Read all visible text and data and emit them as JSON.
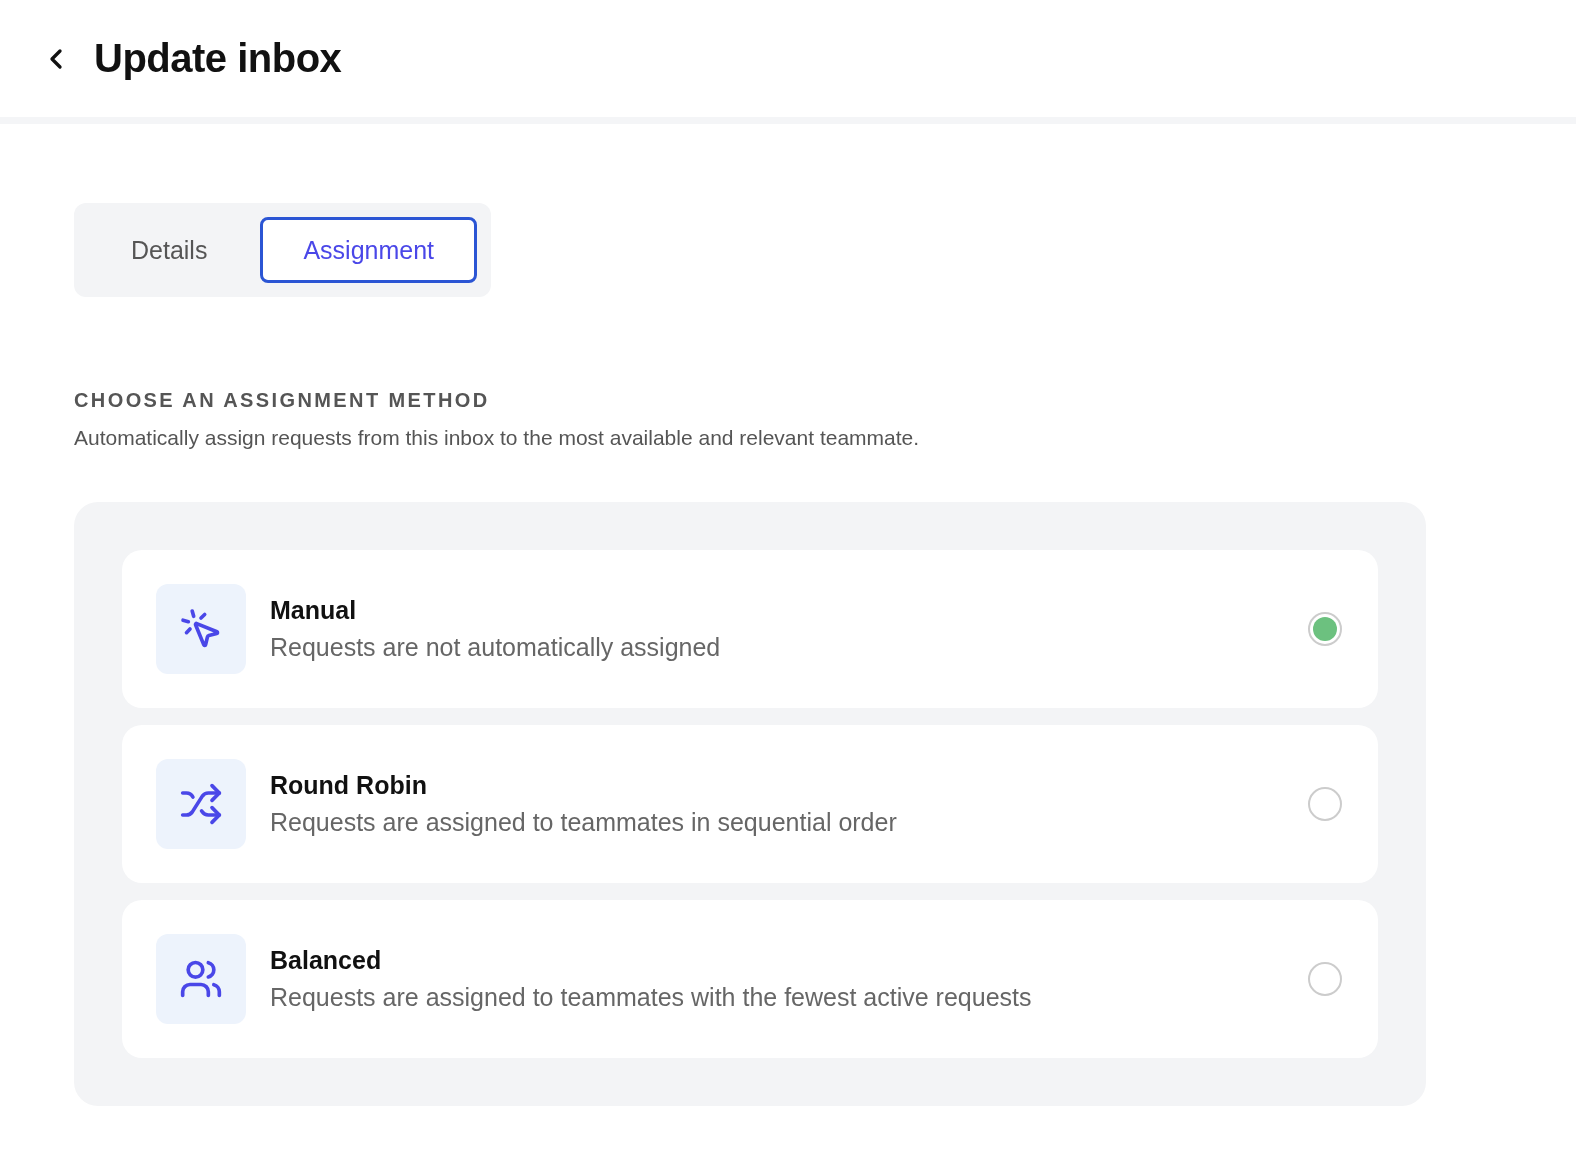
{
  "header": {
    "title": "Update inbox"
  },
  "tabs": [
    {
      "label": "Details",
      "selected": false
    },
    {
      "label": "Assignment",
      "selected": true
    }
  ],
  "section": {
    "heading": "CHOOSE AN ASSIGNMENT METHOD",
    "description": "Automatically assign requests from this inbox to the most available and relevant teammate."
  },
  "options": [
    {
      "kind": "manual",
      "title": "Manual",
      "description": "Requests are not automatically assigned",
      "selected": true
    },
    {
      "kind": "round_robin",
      "title": "Round Robin",
      "description": "Requests are assigned to teammates in sequential order",
      "selected": false
    },
    {
      "kind": "balanced",
      "title": "Balanced",
      "description": "Requests are assigned to teammates with the fewest active requests",
      "selected": false
    }
  ]
}
